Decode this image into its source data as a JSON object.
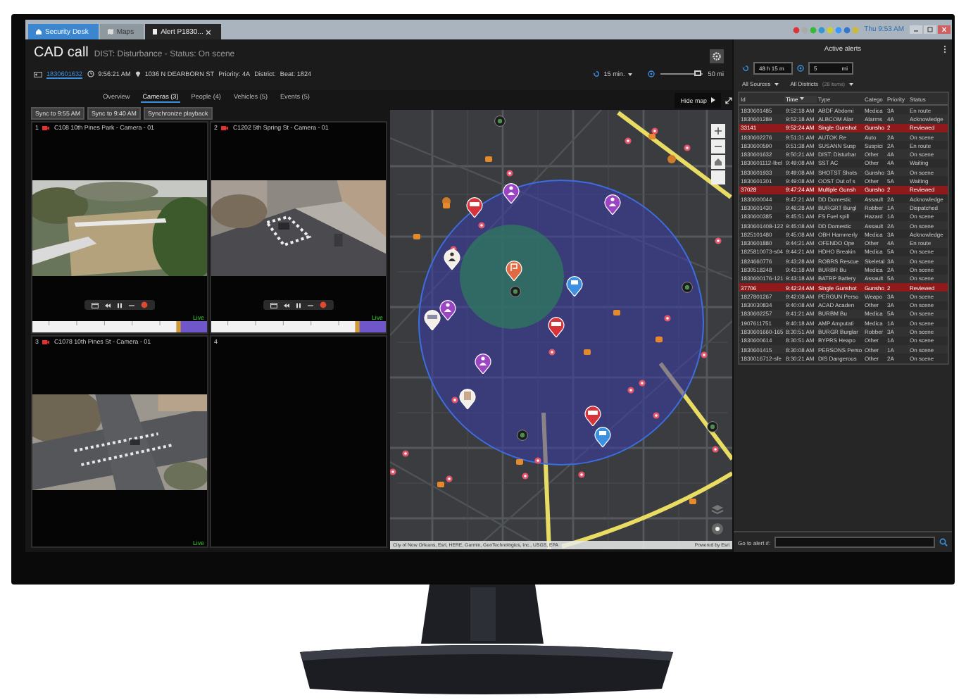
{
  "window_tabs": [
    {
      "label": "Security Desk",
      "kind": "home",
      "selected": false
    },
    {
      "label": "Maps",
      "kind": "map",
      "selected": false
    },
    {
      "label": "Alert P1830...",
      "kind": "alert",
      "selected": true
    }
  ],
  "system_tray": {
    "clock": "Thu 9:53 AM"
  },
  "cad_call": {
    "title": "CAD call",
    "subtitle": "DIST: Disturbance - Status: On scene",
    "id": "1830601632",
    "time": "9:56:21 AM",
    "address": "1036 N DEARBORN ST",
    "priority": "Priority: 4A",
    "district": "District:",
    "beat": "Beat: 1824"
  },
  "map_settings": {
    "time_window": "15 min.",
    "radius": "50 mi",
    "level": 0.9
  },
  "section_tabs": [
    {
      "label": "Overview",
      "selected": false
    },
    {
      "label": "Cameras (3)",
      "selected": true
    },
    {
      "label": "People (4)",
      "selected": false
    },
    {
      "label": "Vehicles (5)",
      "selected": false
    },
    {
      "label": "Events (5)",
      "selected": false
    }
  ],
  "sync_buttons": [
    "Sync to 9:55 AM",
    "Sync to 9:40 AM",
    "Synchronize playback"
  ],
  "cameras": [
    {
      "number": "1",
      "name": "C108 10th Pines Park - Camera - 01",
      "has_feed": true,
      "playback_controls": true,
      "live": "Live"
    },
    {
      "number": "2",
      "name": "C1202 5th Spring St - Camera - 01",
      "has_feed": true,
      "playback_controls": true,
      "live": "Live"
    },
    {
      "number": "3",
      "name": "C1078 10th Pines St - Camera - 01",
      "has_feed": true,
      "playback_controls": false,
      "live": "Live"
    },
    {
      "number": "4",
      "has_feed": false
    }
  ],
  "map": {
    "hide_button": "Hide map",
    "attribution": "City of New Orleans, Esri, HERE, Garmin, GeoTechnologies, Inc., USGS, EPA",
    "powered_by": "Powered by Esri"
  },
  "alerts": {
    "title": "Active alerts",
    "time_filter": "48 h 15 m",
    "distance_filter": "5",
    "distance_unit": "mi",
    "source_filter": "All Sources",
    "district_filter": "All Districts",
    "item_count": "(28 items)",
    "columns": [
      {
        "label": "Id",
        "sorted": false
      },
      {
        "label": "Time",
        "sorted": true
      },
      {
        "label": "Type",
        "sorted": false
      },
      {
        "label": "Catego",
        "sorted": false
      },
      {
        "label": "Priority",
        "sorted": false
      },
      {
        "label": "Status",
        "sorted": false
      }
    ],
    "rows": [
      {
        "id": "1830601485",
        "time": "9:52:18 AM",
        "type": "ABDF Abdomi",
        "category": "Medica",
        "priority": "3A",
        "status": "En route",
        "highlighted": false
      },
      {
        "id": "1830601289",
        "time": "9:52:18 AM",
        "type": "ALBCOM Alar",
        "category": "Alarms",
        "priority": "4A",
        "status": "Acknowledge",
        "highlighted": false
      },
      {
        "id": "33141",
        "time": "9:52:24 AM",
        "type": "Single Gunshot",
        "category": "Gunsho",
        "priority": "2",
        "status": "Reviewed",
        "highlighted": true
      },
      {
        "id": "1830602276",
        "time": "9:51:31 AM",
        "type": "AUTOK Re",
        "category": "Auto",
        "priority": "2A",
        "status": "On scene",
        "highlighted": false
      },
      {
        "id": "1830600590",
        "time": "9:51:38 AM",
        "type": "SUSANN Susp",
        "category": "Suspici",
        "priority": "2A",
        "status": "En route",
        "highlighted": false
      },
      {
        "id": "1830601632",
        "time": "9:50:21 AM",
        "type": "DIST: Disturbar",
        "category": "Other",
        "priority": "4A",
        "status": "On scene",
        "highlighted": false
      },
      {
        "id": "1830601112-Ibel",
        "time": "9:49:08 AM",
        "type": "SST AC",
        "category": "Other",
        "priority": "4A",
        "status": "Waiting",
        "highlighted": false
      },
      {
        "id": "1830601933",
        "time": "9:49:08 AM",
        "type": "SHOTST Shots",
        "category": "Gunsho",
        "priority": "3A",
        "status": "On scene",
        "highlighted": false
      },
      {
        "id": "1830601301",
        "time": "9:49:08 AM",
        "type": "OOST Out of s",
        "category": "Other",
        "priority": "5A",
        "status": "Waiting",
        "highlighted": false
      },
      {
        "id": "37028",
        "time": "9:47:24 AM",
        "type": "Multiple Gunsh",
        "category": "Gunsho",
        "priority": "2",
        "status": "Reviewed",
        "highlighted": true
      },
      {
        "id": "1830600044",
        "time": "9:47:21 AM",
        "type": "DD Domestic",
        "category": "Assault",
        "priority": "2A",
        "status": "Acknowledge",
        "highlighted": false
      },
      {
        "id": "1830601430",
        "time": "9:46:28 AM",
        "type": "BURGRT Burgl",
        "category": "Robber",
        "priority": "1A",
        "status": "Dispatched",
        "highlighted": false
      },
      {
        "id": "1830600385",
        "time": "9:45:51 AM",
        "type": "FS Fuel spill",
        "category": "Hazard",
        "priority": "1A",
        "status": "On scene",
        "highlighted": false
      },
      {
        "id": "1830601408-122",
        "time": "9:45:08 AM",
        "type": "DD Domestic",
        "category": "Assault",
        "priority": "2A",
        "status": "On scene",
        "highlighted": false
      },
      {
        "id": "1825101480",
        "time": "9:45:08 AM",
        "type": "OBH Hammerly",
        "category": "Medica",
        "priority": "3A",
        "status": "Acknowledge",
        "highlighted": false
      },
      {
        "id": "1830601880",
        "time": "9:44:21 AM",
        "type": "OFENDO Ope",
        "category": "Other",
        "priority": "4A",
        "status": "En route",
        "highlighted": false
      },
      {
        "id": "1825810073-s04",
        "time": "9:44:21 AM",
        "type": "HDHO Breakin",
        "category": "Medica",
        "priority": "5A",
        "status": "On scene",
        "highlighted": false
      },
      {
        "id": "1824660776",
        "time": "9:43:28 AM",
        "type": "ROBRS Rescue",
        "category": "Skeletal",
        "priority": "3A",
        "status": "On scene",
        "highlighted": false
      },
      {
        "id": "1830518248",
        "time": "9:43:18 AM",
        "type": "BURBR Bu",
        "category": "Medica",
        "priority": "2A",
        "status": "On scene",
        "highlighted": false
      },
      {
        "id": "1830600176-121",
        "time": "9:43:18 AM",
        "type": "BATRP Battery",
        "category": "Assault",
        "priority": "5A",
        "status": "On scene",
        "highlighted": false
      },
      {
        "id": "37706",
        "time": "9:42:24 AM",
        "type": "Single Gunshot",
        "category": "Gunsho",
        "priority": "2",
        "status": "Reviewed",
        "highlighted": true
      },
      {
        "id": "1827801267",
        "time": "9:42:08 AM",
        "type": "PERGUN Perso",
        "category": "Weapo",
        "priority": "3A",
        "status": "On scene",
        "highlighted": false
      },
      {
        "id": "1830030834",
        "time": "9:40:08 AM",
        "type": "ACAD Acaden",
        "category": "Other",
        "priority": "3A",
        "status": "On scene",
        "highlighted": false
      },
      {
        "id": "1830602257",
        "time": "9:41:21 AM",
        "type": "BURBM Bu",
        "category": "Medica",
        "priority": "5A",
        "status": "On scene",
        "highlighted": false
      },
      {
        "id": "1907611751",
        "time": "9:40:18 AM",
        "type": "AMP Amputati",
        "category": "Medica",
        "priority": "1A",
        "status": "On scene",
        "highlighted": false
      },
      {
        "id": "1830601660-165",
        "time": "8:30:51 AM",
        "type": "BURGR Burglar",
        "category": "Robber",
        "priority": "3A",
        "status": "On scene",
        "highlighted": false
      },
      {
        "id": "1830600614",
        "time": "8:30:51 AM",
        "type": "BYPRS Heapo",
        "category": "Other",
        "priority": "1A",
        "status": "On scene",
        "highlighted": false
      },
      {
        "id": "1830601415",
        "time": "8:30:08 AM",
        "type": "PERSONS Perso",
        "category": "Other",
        "priority": "1A",
        "status": "On scene",
        "highlighted": false
      },
      {
        "id": "1830016712-sfe",
        "time": "8:30:21 AM",
        "type": "DIS Dangerous",
        "category": "Other",
        "priority": "2A",
        "status": "On scene",
        "highlighted": false
      }
    ],
    "goto_label": "Go to alert #:"
  }
}
